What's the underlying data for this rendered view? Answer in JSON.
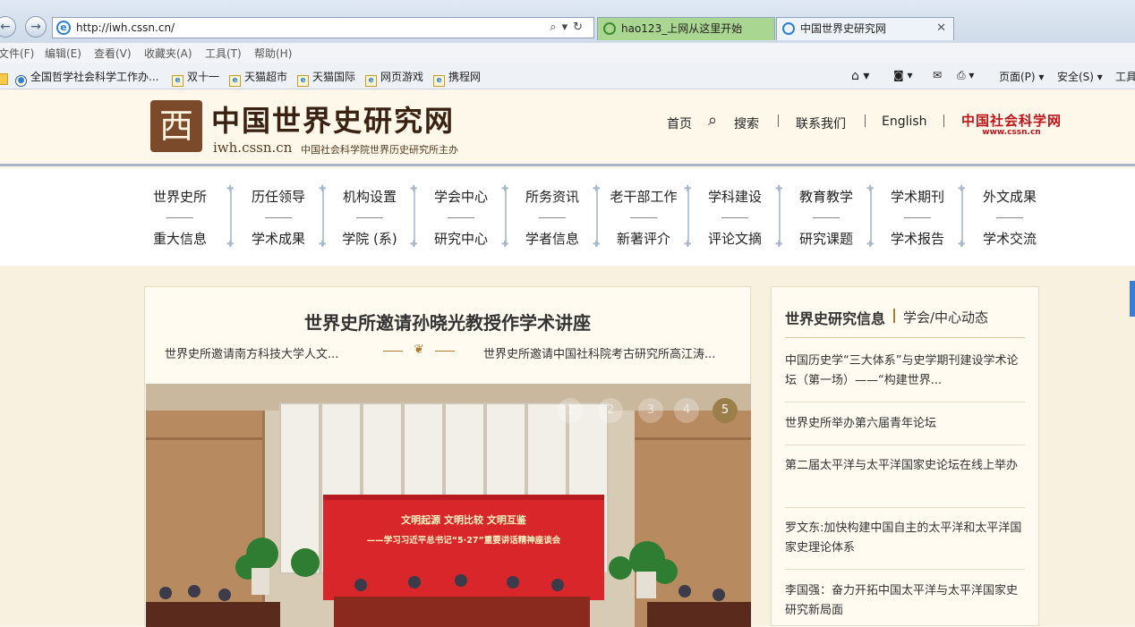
{
  "browser": {
    "url": "http://iwh.cssn.cn/",
    "tabs": [
      {
        "label": "hao123_上网从这里开始"
      },
      {
        "label": "中国世界史研究网"
      }
    ],
    "menu": [
      "文件(F)",
      "编辑(E)",
      "查看(V)",
      "收藏夹(A)",
      "工具(T)",
      "帮助(H)"
    ],
    "favorites": [
      "全国哲学社会科学工作办...",
      "双十一",
      "天猫超市",
      "天猫国际",
      "网页游戏",
      "携程网"
    ],
    "commands": {
      "page": "页面(P) ▾",
      "safety": "安全(S) ▾",
      "tools": "工具"
    }
  },
  "header": {
    "logo_mark": "西",
    "title": "中国世界史研究网",
    "domain": "iwh.cssn.cn",
    "subtitle": "中国社会科学院世界历史研究所主办",
    "nav": {
      "home": "首页",
      "search": "搜索",
      "contact": "联系我们",
      "english": "English"
    },
    "partner": {
      "name": "中国社会科学网",
      "url": "www.cssn.cn"
    }
  },
  "mainnav": [
    {
      "top": "世界史所",
      "bottom": "重大信息"
    },
    {
      "top": "历任领导",
      "bottom": "学术成果"
    },
    {
      "top": "机构设置",
      "bottom": "学院 (系)"
    },
    {
      "top": "学会中心",
      "bottom": "研究中心"
    },
    {
      "top": "所务资讯",
      "bottom": "学者信息"
    },
    {
      "top": "老干部工作",
      "bottom": "新著评介"
    },
    {
      "top": "学科建设",
      "bottom": "评论文摘"
    },
    {
      "top": "教育教学",
      "bottom": "研究课题"
    },
    {
      "top": "学术期刊",
      "bottom": "学术报告"
    },
    {
      "top": "外文成果",
      "bottom": "学术交流"
    }
  ],
  "feature": {
    "title": "世界史所邀请孙晓光教授作学术讲座",
    "sub_left": "世界史所邀请南方科技大学人文...",
    "sub_right": "世界史所邀请中国社科院考古研究所高江涛...",
    "banner_line1": "文明起源  文明比较  文明互鉴",
    "banner_line2": "——学习习近平总书记“5·27”重要讲话精神座谈会",
    "dots": [
      "1",
      "2",
      "3",
      "4",
      "5"
    ],
    "active_dot": 5
  },
  "sidebar": {
    "title": "世界史研究信息",
    "tab2": "学会/中心动态",
    "news": [
      "中国历史学“三大体系”与史学期刊建设学术论坛（第一场）——“构建世界...",
      "世界史所举办第六届青年论坛",
      "第二届太平洋与太平洋国家史论坛在线上举办",
      "罗文东:加快构建中国自主的太平洋和太平洋国家史理论体系",
      "李国强：奋力开拓中国太平洋与太平洋国家史研究新局面"
    ]
  },
  "colors": {
    "brand_brown": "#7a4a2a",
    "accent_gold": "#b07a30",
    "banner_red": "#d8262a",
    "cssn_red": "#c0141a"
  }
}
